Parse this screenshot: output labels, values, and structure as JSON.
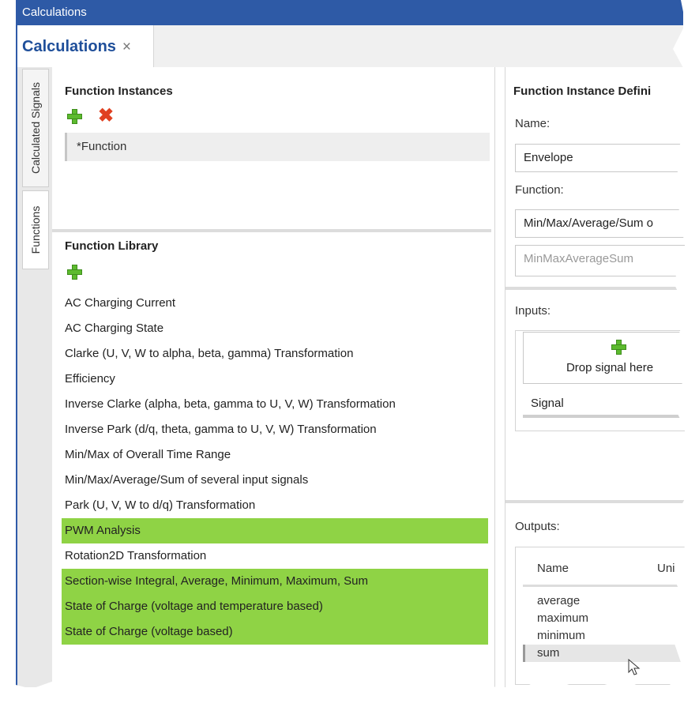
{
  "window": {
    "title": "Calculations"
  },
  "doc_tab": {
    "label": "Calculations",
    "close": "×"
  },
  "side_tabs": [
    "Calculated Signals",
    "Functions"
  ],
  "function_instances": {
    "title": "Function Instances",
    "items": [
      "*Function"
    ],
    "add_icon": "plus-icon",
    "delete_icon": "delete-icon"
  },
  "function_library": {
    "title": "Function Library",
    "items": [
      {
        "label": "AC Charging Current",
        "highlighted": false
      },
      {
        "label": "AC Charging State",
        "highlighted": false
      },
      {
        "label": "Clarke (U, V, W to alpha, beta, gamma) Transformation",
        "highlighted": false
      },
      {
        "label": "Efficiency",
        "highlighted": false
      },
      {
        "label": "Inverse Clarke (alpha, beta, gamma to U, V, W) Transformation",
        "highlighted": false
      },
      {
        "label": "Inverse Park (d/q, theta, gamma to U, V, W) Transformation",
        "highlighted": false
      },
      {
        "label": "Min/Max of Overall Time Range",
        "highlighted": false
      },
      {
        "label": "Min/Max/Average/Sum of several input signals",
        "highlighted": false
      },
      {
        "label": "Park (U, V, W to d/q) Transformation",
        "highlighted": false
      },
      {
        "label": "PWM Analysis",
        "highlighted": true
      },
      {
        "label": "Rotation2D Transformation",
        "highlighted": false
      },
      {
        "label": "Section-wise Integral, Average, Minimum, Maximum, Sum",
        "highlighted": true
      },
      {
        "label": "State of Charge (voltage and temperature based)",
        "highlighted": true
      },
      {
        "label": "State of Charge (voltage based)",
        "highlighted": true
      }
    ],
    "highlight_color": "#8fd345"
  },
  "definition": {
    "title": "Function Instance Defini",
    "name_label": "Name:",
    "name_value": "Envelope",
    "function_label": "Function:",
    "function_value": "Min/Max/Average/Sum o",
    "function_id": "MinMaxAverageSum",
    "inputs_label": "Inputs:",
    "drop_text": "Drop signal here",
    "input_signal": "Signal",
    "outputs_label": "Outputs:",
    "outputs_columns": [
      "Name",
      "Uni"
    ],
    "outputs": [
      "average",
      "maximum",
      "minimum",
      "sum"
    ],
    "selected_output": "sum"
  },
  "colors": {
    "titlebar": "#2e5aa6",
    "tab_text": "#1f4f9a",
    "add": "#5cba2e",
    "delete": "#e04020"
  }
}
